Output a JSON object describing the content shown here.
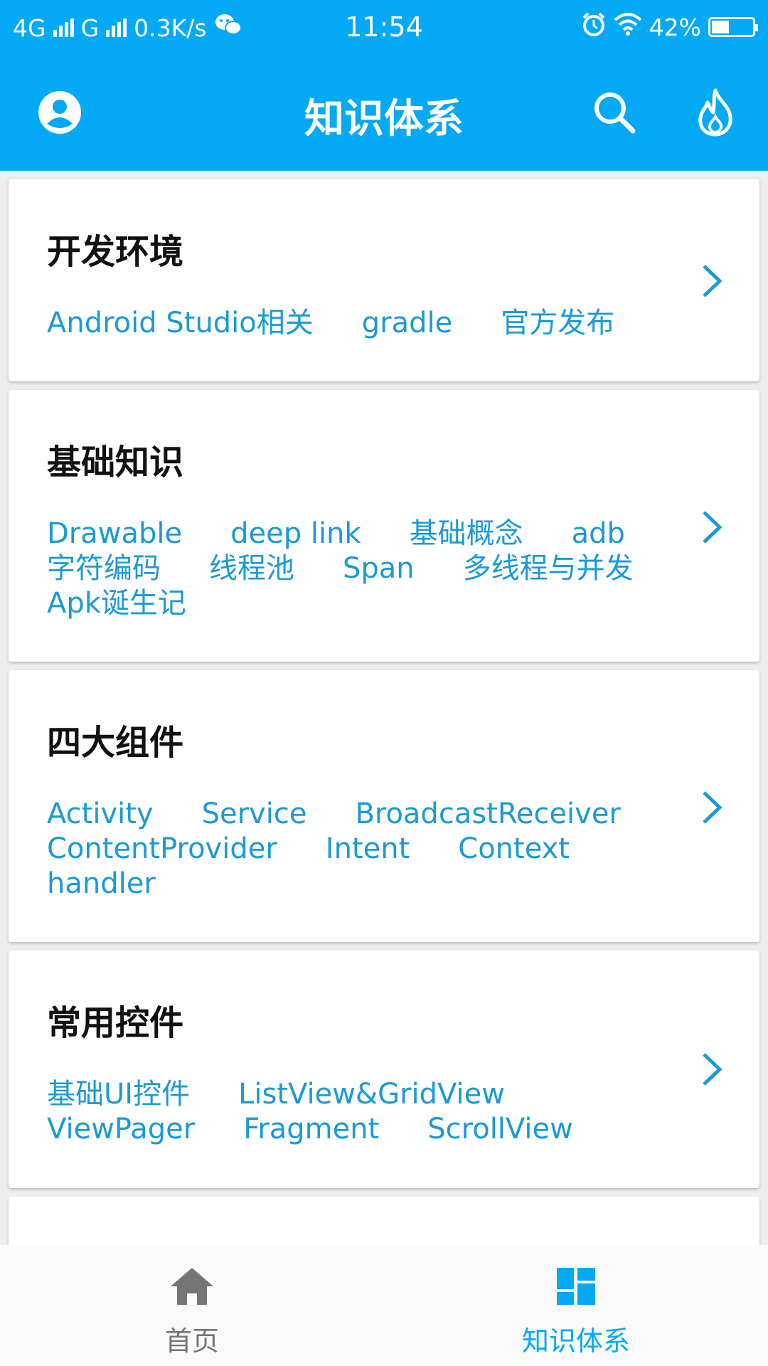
{
  "status_bar": {
    "network1": "4G",
    "network2": "G",
    "speed": "0.3K/s",
    "time": "11:54",
    "battery_text": "42%",
    "battery_level": 0.42
  },
  "app_bar": {
    "title": "知识体系",
    "icons": [
      "account-icon",
      "search-icon",
      "fire-icon"
    ]
  },
  "colors": {
    "primary": "#03a9f4",
    "tag_text": "#1a9ad6",
    "nav_inactive": "#757575"
  },
  "categories": [
    {
      "title": "开发环境",
      "tags": [
        "Android Studio相关",
        "gradle",
        "官方发布"
      ]
    },
    {
      "title": "基础知识",
      "tags": [
        "Drawable",
        "deep link",
        "基础概念",
        "adb",
        "字符编码",
        "线程池",
        "Span",
        "多线程与并发",
        "Apk诞生记"
      ]
    },
    {
      "title": "四大组件",
      "tags": [
        "Activity",
        "Service",
        "BroadcastReceiver",
        "ContentProvider",
        "Intent",
        "Context",
        "handler"
      ]
    },
    {
      "title": "常用控件",
      "tags": [
        "基础UI控件",
        "ListView&GridView",
        "ViewPager",
        "Fragment",
        "ScrollView"
      ]
    }
  ],
  "bottom_nav": {
    "items": [
      {
        "label": "首页",
        "icon": "home-icon",
        "active": false
      },
      {
        "label": "知识体系",
        "icon": "dashboard-icon",
        "active": true
      }
    ]
  }
}
